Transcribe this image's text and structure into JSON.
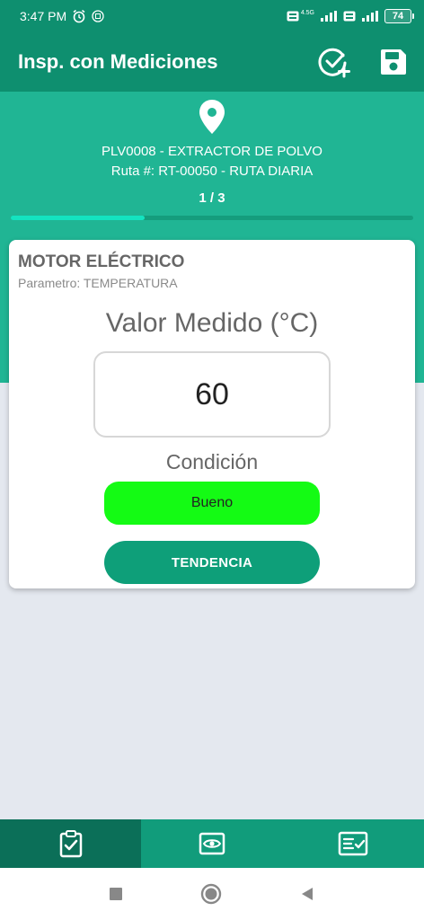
{
  "status_bar": {
    "time": "3:47 PM",
    "network_label_1": "4.5G",
    "battery": "74",
    "icons": [
      "alarm-icon",
      "sim-icon",
      "signal-icon",
      "wifi-icon",
      "battery-icon"
    ]
  },
  "app_bar": {
    "title": "Insp. con Mediciones",
    "actions": [
      "check-add-icon",
      "save-icon"
    ]
  },
  "hero": {
    "equipment": "PLV0008 - EXTRACTOR DE POLVO",
    "route": "Ruta #: RT-00050 - RUTA DIARIA",
    "progress_text": "1 / 3",
    "progress_fraction": 0.333
  },
  "card": {
    "title": "MOTOR ELÉCTRICO",
    "parameter": "Parametro: TEMPERATURA",
    "measure_label": "Valor Medido (°C)",
    "measure_value": "60",
    "condition_label": "Condición",
    "condition_value": "Bueno",
    "condition_color": "#14fb14",
    "trend_button": "TENDENCIA"
  },
  "bottom_nav": {
    "items": [
      "clipboard-check-icon",
      "eye-icon",
      "checklist-icon"
    ],
    "active_index": 0
  },
  "colors": {
    "primary_dark": "#0e8f6f",
    "primary": "#20b594",
    "accent": "#14e3c0",
    "nav_active": "#0b6f58"
  }
}
